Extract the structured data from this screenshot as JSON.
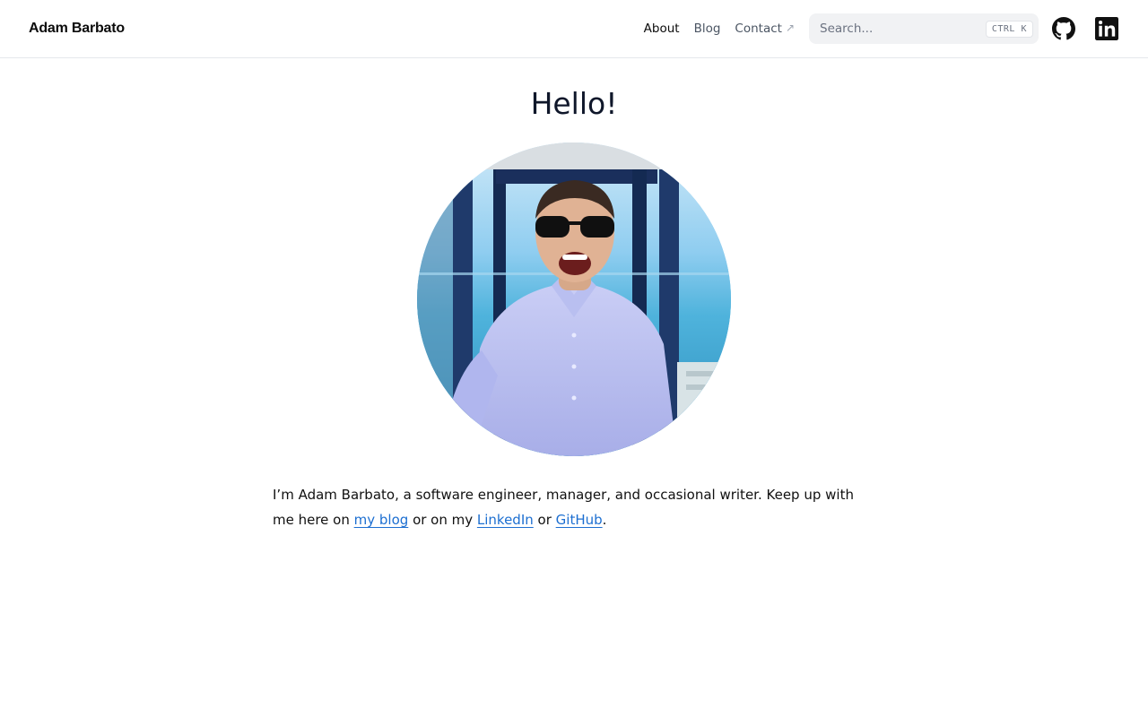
{
  "header": {
    "brand": "Adam Barbato",
    "nav": {
      "about": "About",
      "blog": "Blog",
      "contact": "Contact",
      "contact_icon": "external-link-arrow-icon"
    },
    "search": {
      "placeholder": "Search...",
      "shortcut_ctrl": "CTRL",
      "shortcut_key": "K"
    },
    "social": {
      "github_icon": "github-icon",
      "linkedin_icon": "linkedin-icon"
    }
  },
  "main": {
    "title": "Hello!",
    "bio": {
      "part1": "I’m Adam Barbato, a software engineer, manager, and occasional writer. Keep up with me here on ",
      "link_blog": "my blog",
      "part2": " or on my ",
      "link_linkedin": "LinkedIn",
      "part3": " or ",
      "link_github": "GitHub",
      "part4": "."
    }
  },
  "colors": {
    "link": "#1d6fd1",
    "heading": "#0f172a",
    "border": "#e5e7eb",
    "search_bg": "#f1f2f4"
  }
}
